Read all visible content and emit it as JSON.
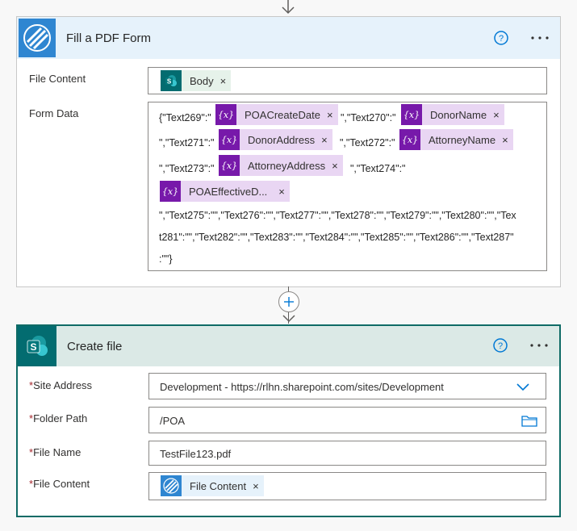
{
  "colors": {
    "accent": "#0078d4",
    "var_token": "#7719aa",
    "sharepoint": "#036c70",
    "required": "#a4262c"
  },
  "pdf_action": {
    "title": "Fill a PDF Form",
    "help_icon": "question-circle-icon",
    "more_icon": "ellipsis-icon",
    "file_content": {
      "label": "File Content",
      "token": "Body"
    },
    "form_data": {
      "label": "Form Data",
      "t1": "{\"Text269\":\"",
      "tok1": "POACreateDate",
      "t2": "\",\"Text270\":\"",
      "tok2": "DonorName",
      "t3": "\",\"Text271\":\"",
      "tok3": "DonorAddress",
      "t4": "\",\"Text272\":\"",
      "tok4": "AttorneyName",
      "t5": "\",\"Text273\":\"",
      "tok5": "AttorneyAddress",
      "t6": "\",\"Text274\":\"",
      "tok6": "POAEffectiveD...",
      "line1": "\",\"Text275\":\"\",\"Text276\":\"\",\"Text277\":\"\",\"Text278\":\"\",\"Text279\":\"\",\"Text280\":\"\",\"Tex",
      "line2": "t281\":\"\",\"Text282\":\"\",\"Text283\":\"\",\"Text284\":\"\",\"Text285\":\"\",\"Text286\":\"\",\"Text287\"",
      "line3": ":\"\"}"
    }
  },
  "create_file": {
    "title": "Create file",
    "required_marker": "*",
    "site_address": {
      "label": "Site Address",
      "value": "Development - https://rlhn.sharepoint.com/sites/Development"
    },
    "folder_path": {
      "label": "Folder Path",
      "value": "/POA"
    },
    "file_name": {
      "label": "File Name",
      "value": "TestFile123.pdf"
    },
    "file_content": {
      "label": "File Content",
      "token": "File Content"
    }
  },
  "token_remove_glyph": "×",
  "var_icon_text": "{x}"
}
